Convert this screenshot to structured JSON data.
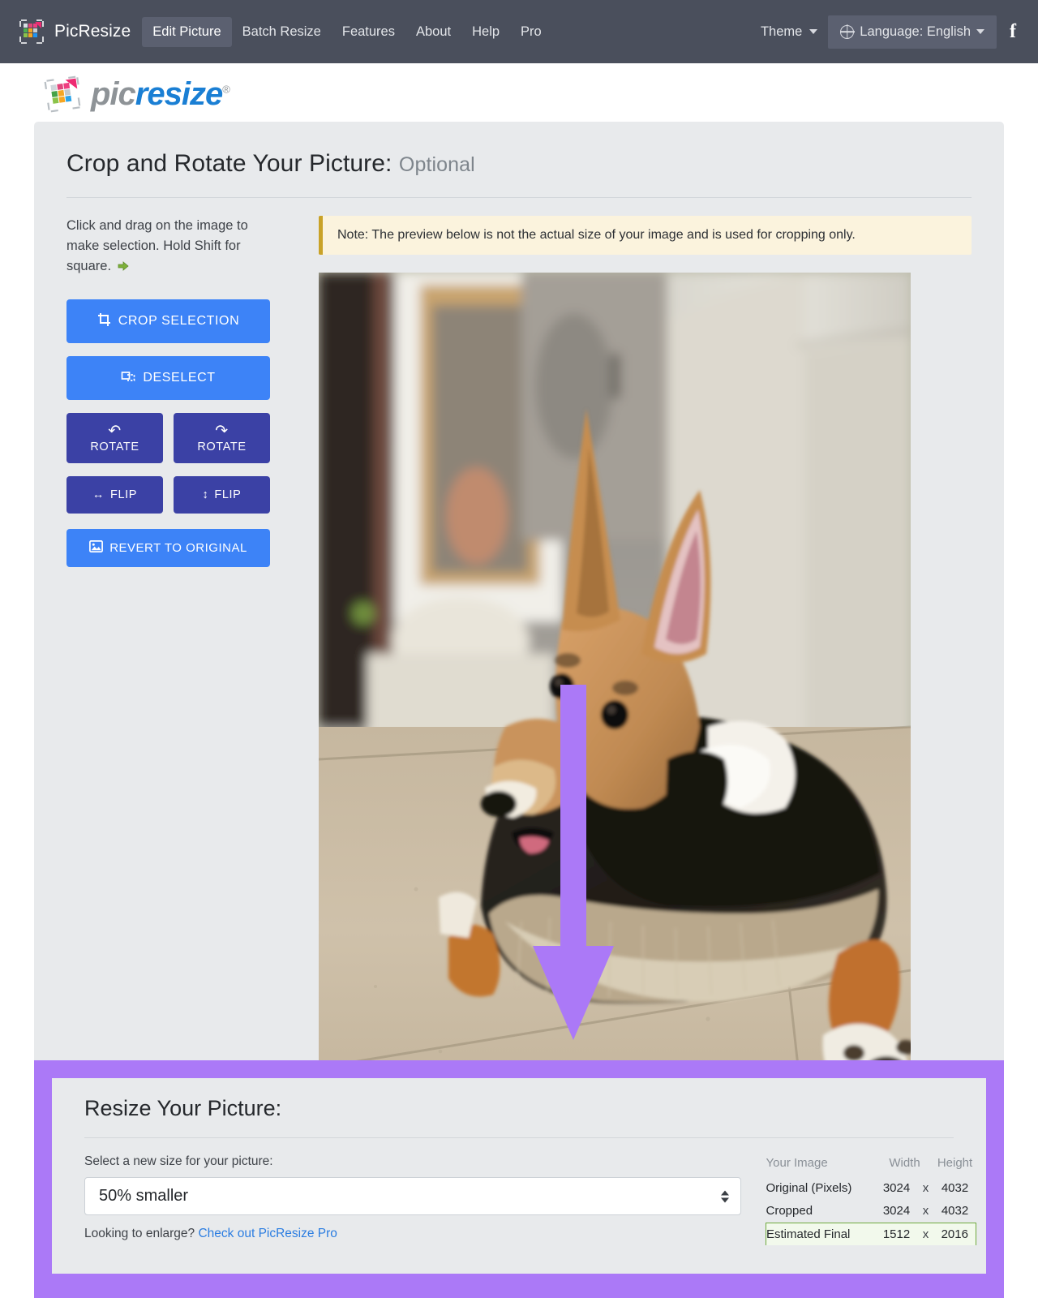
{
  "navbar": {
    "brand": "PicResize",
    "brand_logo_icon": "picresize-mosaic-icon",
    "links": [
      {
        "label": "Edit Picture",
        "active": true
      },
      {
        "label": "Batch Resize",
        "active": false
      },
      {
        "label": "Features",
        "active": false
      },
      {
        "label": "About",
        "active": false
      },
      {
        "label": "Help",
        "active": false
      },
      {
        "label": "Pro",
        "active": false
      }
    ],
    "theme_label": "Theme",
    "language_label": "Language: English",
    "facebook_icon": "facebook-icon",
    "bg_color": "#4a4f5c",
    "active_tab_color": "#5b6070"
  },
  "logo": {
    "part1": "pic",
    "part2": "resize",
    "registered": "®",
    "part1_color": "#8e9397",
    "part2_color": "#1a7fd4"
  },
  "page": {
    "title": "Crop and Rotate Your Picture:",
    "title_suffix": "Optional"
  },
  "sidebar": {
    "hint": "Click and drag on the image to make selection. Hold Shift for square.",
    "hint_arrow_icon": "green-right-arrow-icon",
    "buttons": [
      {
        "label": "CROP SELECTION",
        "icon": "crop-icon",
        "style": "light-blue"
      },
      {
        "label": "DESELECT",
        "icon": "deselect-icon",
        "style": "light-blue"
      },
      {
        "label": "ROTATE",
        "icon": "rotate-ccw-icon",
        "style": "dark-blue"
      },
      {
        "label": "ROTATE",
        "icon": "rotate-cw-icon",
        "style": "dark-blue"
      },
      {
        "label": "FLIP",
        "icon": "flip-horizontal-icon",
        "style": "dark-blue"
      },
      {
        "label": "FLIP",
        "icon": "flip-vertical-icon",
        "style": "dark-blue"
      },
      {
        "label": "REVERT TO ORIGINAL",
        "icon": "image-icon",
        "style": "light-blue"
      }
    ],
    "light_blue": "#3d83f7",
    "dark_blue": "#3b41a5"
  },
  "note": {
    "text": "Note: The preview below is not the actual size of your image and is used for cropping only.",
    "bg_color": "#fbf3dd",
    "accent_color": "#c9a227"
  },
  "preview": {
    "alt": "Corgi dog lying on tile floor in a living room",
    "annotation_icon": "purple-down-arrow-annotation",
    "annotation_color": "#ab79f7"
  },
  "resize": {
    "title": "Resize Your Picture:",
    "select_label": "Select a new size for your picture:",
    "selected_size": "50% smaller",
    "enlarge_text": "Looking to enlarge?",
    "enlarge_link": "Check out PicResize Pro",
    "highlight_color": "#ab79f7",
    "table": {
      "headers": [
        "Your Image",
        "Width",
        "Height"
      ],
      "rows": [
        {
          "label": "Original (Pixels)",
          "width": "3024",
          "x": "x",
          "height": "4032",
          "highlight": false
        },
        {
          "label": "Cropped",
          "width": "3024",
          "x": "x",
          "height": "4032",
          "highlight": false
        },
        {
          "label": "Estimated Final",
          "width": "1512",
          "x": "x",
          "height": "2016",
          "highlight": true
        }
      ]
    }
  }
}
